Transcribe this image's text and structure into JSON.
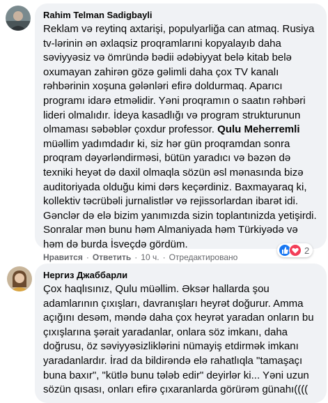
{
  "comments": [
    {
      "author": "Rahim Telman Sadigbayli",
      "paragraphs": [
        {
          "text": "Reklam və reytinq axtarişi, populyarliğa can atmaq. Rusiya tv-lərinin ən əxlaqsiz proqramlarıni kopyalayıb daha səviyyəsiz və ömründə bədii ədəbiyyat belə kitab belə oxumayan zahirən gözə gəlimli daha çox TV kanalı rəhbərinin xoşuna gələnləri efirə doldurmaq. Aparıcı programı idarə etməlidir. Yəni proqramın o saatın rəhbəri lideri olmalıdır. İdeya kasadlığı və program strukturunun olmaması səbəblər çoxdur professor. "
        },
        {
          "bold": "Qulu Meherremli"
        },
        {
          "text": " müəllim yadımdadır ki, siz hər gün proqramdan sonra proqram dəyərləndirməsi, bütün yaradıcı və bəzən də texniki heyət də daxil olmaqla sözün əsl mənasında bizə auditoriyada olduğu kimi dərs keçərdiniz. Baxmayaraq ki, kollektiv təcrübəli jurnalistlər və rejissorlardan ibarət idi. Gənclər də elə bizim yanımızda sizin toplantınizda yetişirdi. Sonralar mən bunu həm Almaniyada həm Türkiyədə və həm də burda İsveçdə gördüm."
        }
      ],
      "actions": {
        "like": "Нравится",
        "reply": "Ответить",
        "time": "10 ч.",
        "edited": "Отредактировано"
      },
      "reactions": {
        "count": "2",
        "icons": [
          "like-icon",
          "love-icon"
        ],
        "colors": {
          "like": "#1877f2",
          "love": "#f33e58"
        }
      }
    },
    {
      "author": "Нергиз Джаббарли",
      "paragraphs": [
        {
          "text": "Çox haqlısınız, Qulu müəllim. Əksər hallarda şou adamlarının çıxışları, davranışları heyrət doğurur. Amma açığını desəm, məndə daha çox heyrət yaradan onların bu çıxışlarına şərait yaradanlar, onlara söz imkanı, daha doğrusu, öz səviyyəsizliklərini nümayiş etdirmək imkanı yaradanlardır. İrad da bildirəndə elə rahatlıqla \"tamaşaçı buna baxır\", \"kütlə bunu tələb edir\" deyirlər ki... Yəni uzun sözün qısası, onları efirə çıxaranlarda görürəm günahı(((("
        }
      ]
    }
  ],
  "colors": {
    "bubble": "#f0f2f5",
    "meta": "#65676b",
    "text": "#050505"
  }
}
